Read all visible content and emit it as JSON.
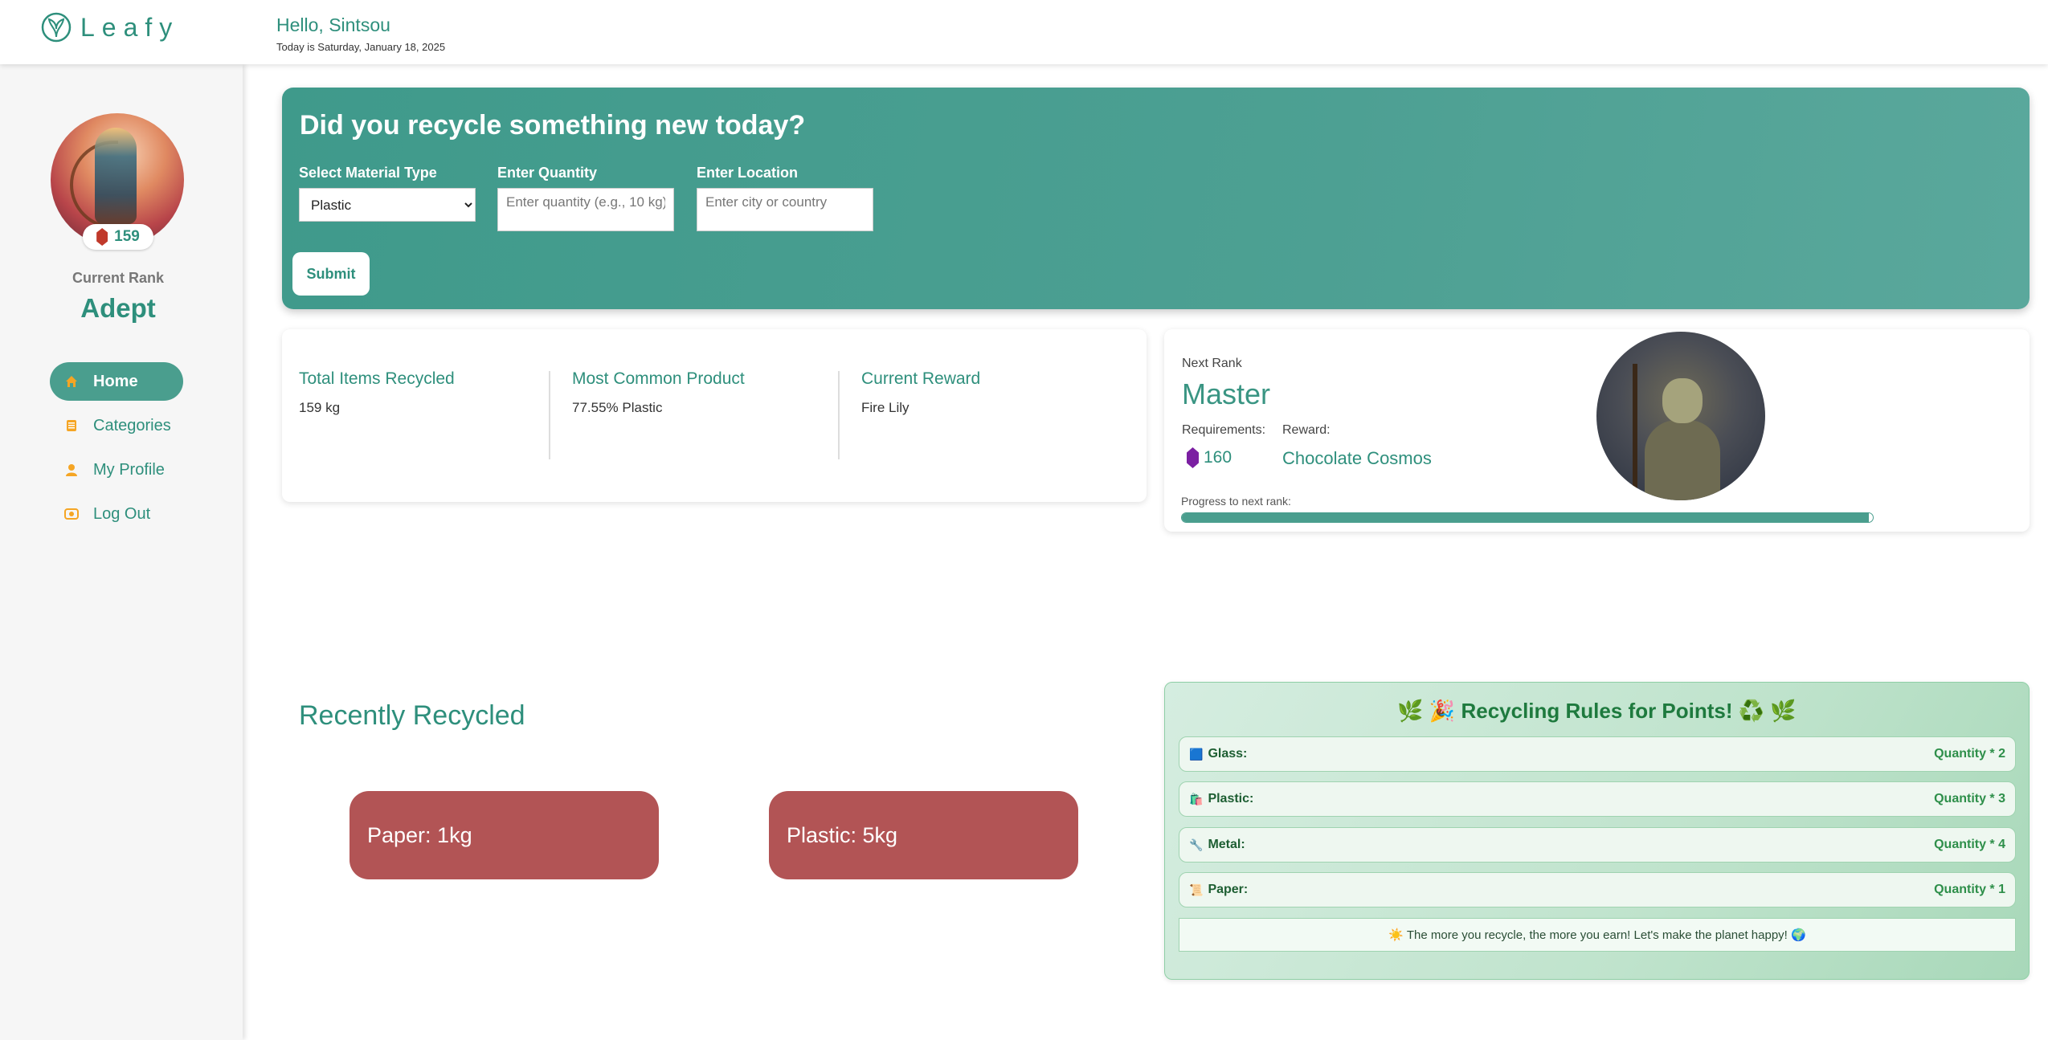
{
  "header": {
    "app_name": "Leafy",
    "greeting": "Hello, Sintsou",
    "date_text": "Today is Saturday, January 18, 2025"
  },
  "sidebar": {
    "points": "159",
    "rank_label": "Current Rank",
    "rank_value": "Adept",
    "items": [
      {
        "label": "Home",
        "icon": "home-icon",
        "active": true
      },
      {
        "label": "Categories",
        "icon": "categories-icon",
        "active": false
      },
      {
        "label": "My Profile",
        "icon": "user-icon",
        "active": false
      },
      {
        "label": "Log Out",
        "icon": "logout-icon",
        "active": false
      }
    ]
  },
  "recycle_form": {
    "title": "Did you recycle something new today?",
    "material_label": "Select Material Type",
    "material_selected": "Plastic",
    "quantity_label": "Enter Quantity",
    "quantity_placeholder": "Enter quantity (e.g., 10 kg)",
    "location_label": "Enter Location",
    "location_placeholder": "Enter city or country",
    "submit_label": "Submit"
  },
  "stats": [
    {
      "title": "Total Items Recycled",
      "value": "159 kg"
    },
    {
      "title": "Most Common Product",
      "value": "77.55% Plastic"
    },
    {
      "title": "Current Reward",
      "value": "Fire Lily"
    }
  ],
  "next_rank": {
    "label": "Next Rank",
    "rank": "Master",
    "requirements_label": "Requirements:",
    "reward_label": "Reward:",
    "requirement_points": "160",
    "reward": "Chocolate Cosmos",
    "progress_label": "Progress to next rank:",
    "progress_fraction": 0.994
  },
  "recent": {
    "title": "Recently Recycled",
    "items": [
      "Paper: 1kg",
      "Plastic: 5kg"
    ]
  },
  "rules": {
    "title": "🌿 🎉 Recycling Rules for Points! ♻️ 🌿",
    "items": [
      {
        "icon": "🟦",
        "name": "Glass:",
        "formula": "Quantity * 2"
      },
      {
        "icon": "🛍️",
        "name": "Plastic:",
        "formula": "Quantity * 3"
      },
      {
        "icon": "🔧",
        "name": "Metal:",
        "formula": "Quantity * 4"
      },
      {
        "icon": "📜",
        "name": "Paper:",
        "formula": "Quantity * 1"
      }
    ],
    "footer": "☀️ The more you recycle, the more you earn! Let's make the planet happy! 🌍"
  },
  "colors": {
    "brand": "#2e8f7c",
    "recent_card": "#b25455",
    "nav_accent": "#f5a524"
  }
}
